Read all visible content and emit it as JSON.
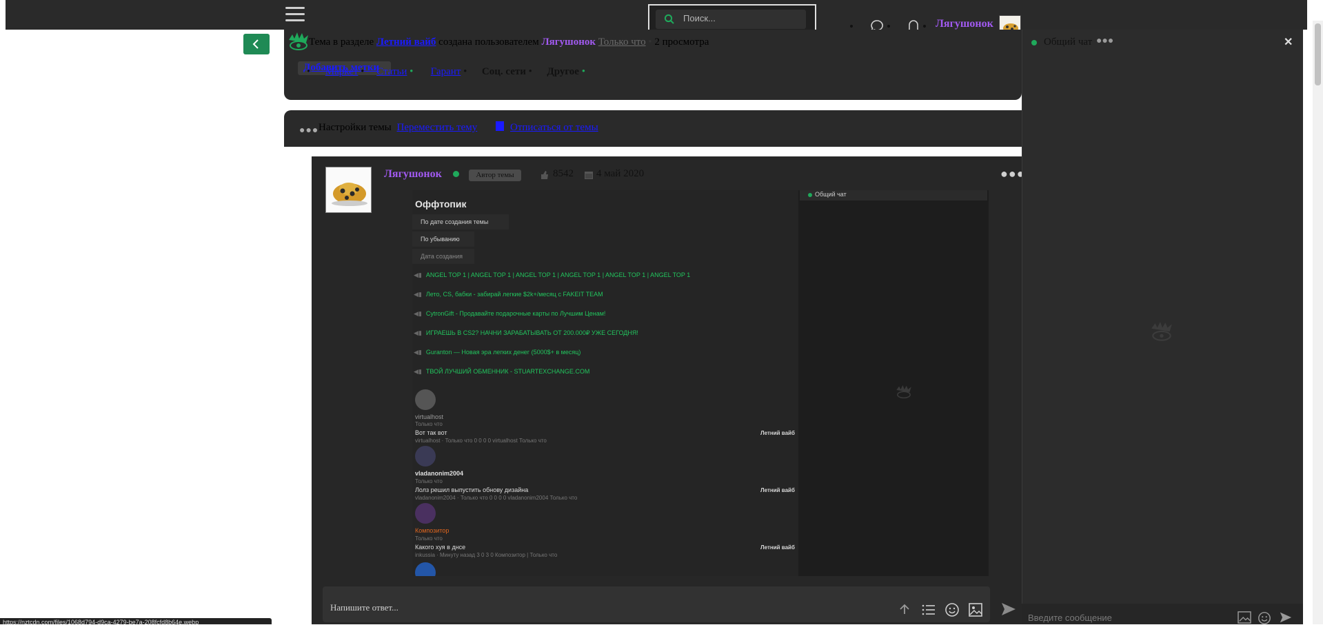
{
  "header": {
    "search_placeholder": "Поиск...",
    "username": "Лягушонок"
  },
  "thread": {
    "created_prefix": "Тема в разделе",
    "section": "Летний вайб",
    "created_by": "создана пользователем",
    "author": "Лягушонок",
    "time": "Только что",
    "views": "2 просмотра",
    "add_tags": "Добавить метки",
    "nav": [
      "Маркет",
      "Статьи",
      "Гарант",
      "Соц. сети",
      "Другое"
    ]
  },
  "settings": {
    "label": "Настройки темы",
    "rename": "Переместить тему",
    "unsubscribe": "Отписаться от темы"
  },
  "post": {
    "author": "Лягушонок",
    "badge": "Автор темы",
    "likes": "8542",
    "date": "4 май 2020"
  },
  "embedded": {
    "title": "Оффтопик",
    "sorts": [
      "По дате создания темы",
      "По убыванию",
      "Дата создания"
    ],
    "threads": [
      "ANGEL TOP 1 | ANGEL TOP 1 | ANGEL TOP 1 | ANGEL TOP 1 | ANGEL TOP 1 | ANGEL TOP 1",
      "Лето, CS, бабки - забирай легкие $2k+/месяц с FAKEIT TEAM",
      "CytronGift - Продавайте подарочные карты по Лучшим Ценам!",
      "ИГРАЕШЬ В CS2? НАЧНИ ЗАРАБАТЫВАТЬ ОТ 200.000₽ УЖЕ СЕГОДНЯ!",
      "Guranton — Новая эра легких денег (5000$+ в месяц)",
      "ТВОЙ ЛУЧШИЙ ОБМЕННИК - STUARTEXCHANGE.COM"
    ],
    "chat_label": "Общий чат",
    "messages": [
      {
        "name": "virtualhost",
        "time": "Только что",
        "text": "Вот так вот",
        "section": "Летний вайб",
        "meta": "virtualhost · Только что 0 0 0 0    virtualhost Только что"
      },
      {
        "name": "vladanonim2004",
        "time": "Только что",
        "text": "Лолз решил выпустить обнову дизайна",
        "section": "Летний вайб",
        "meta": "vladanonim2004 · Только что 0 0 0 0    vladanonim2004 Только что"
      },
      {
        "name": "Композитор",
        "time": "Только что",
        "text": "Какого хуя в днсе",
        "section": "Летний вайб",
        "meta": "inkussia · Минуту назад 3 0 3 0    Композитор | Только что"
      }
    ]
  },
  "reply": {
    "placeholder": "Напишите ответ..."
  },
  "chat": {
    "title": "Общий чат",
    "input_placeholder": "Введите сообщение"
  },
  "status_bar": {
    "url": "https://nztcdn.com/files/1068d794-d9ca-4279-be7a-208fcfd8b64e.webp"
  },
  "colors": {
    "accent": "#1f8a55",
    "username": "#a25af2",
    "thread_link": "#22c55e",
    "bg_dark": "#2a2a2a"
  }
}
